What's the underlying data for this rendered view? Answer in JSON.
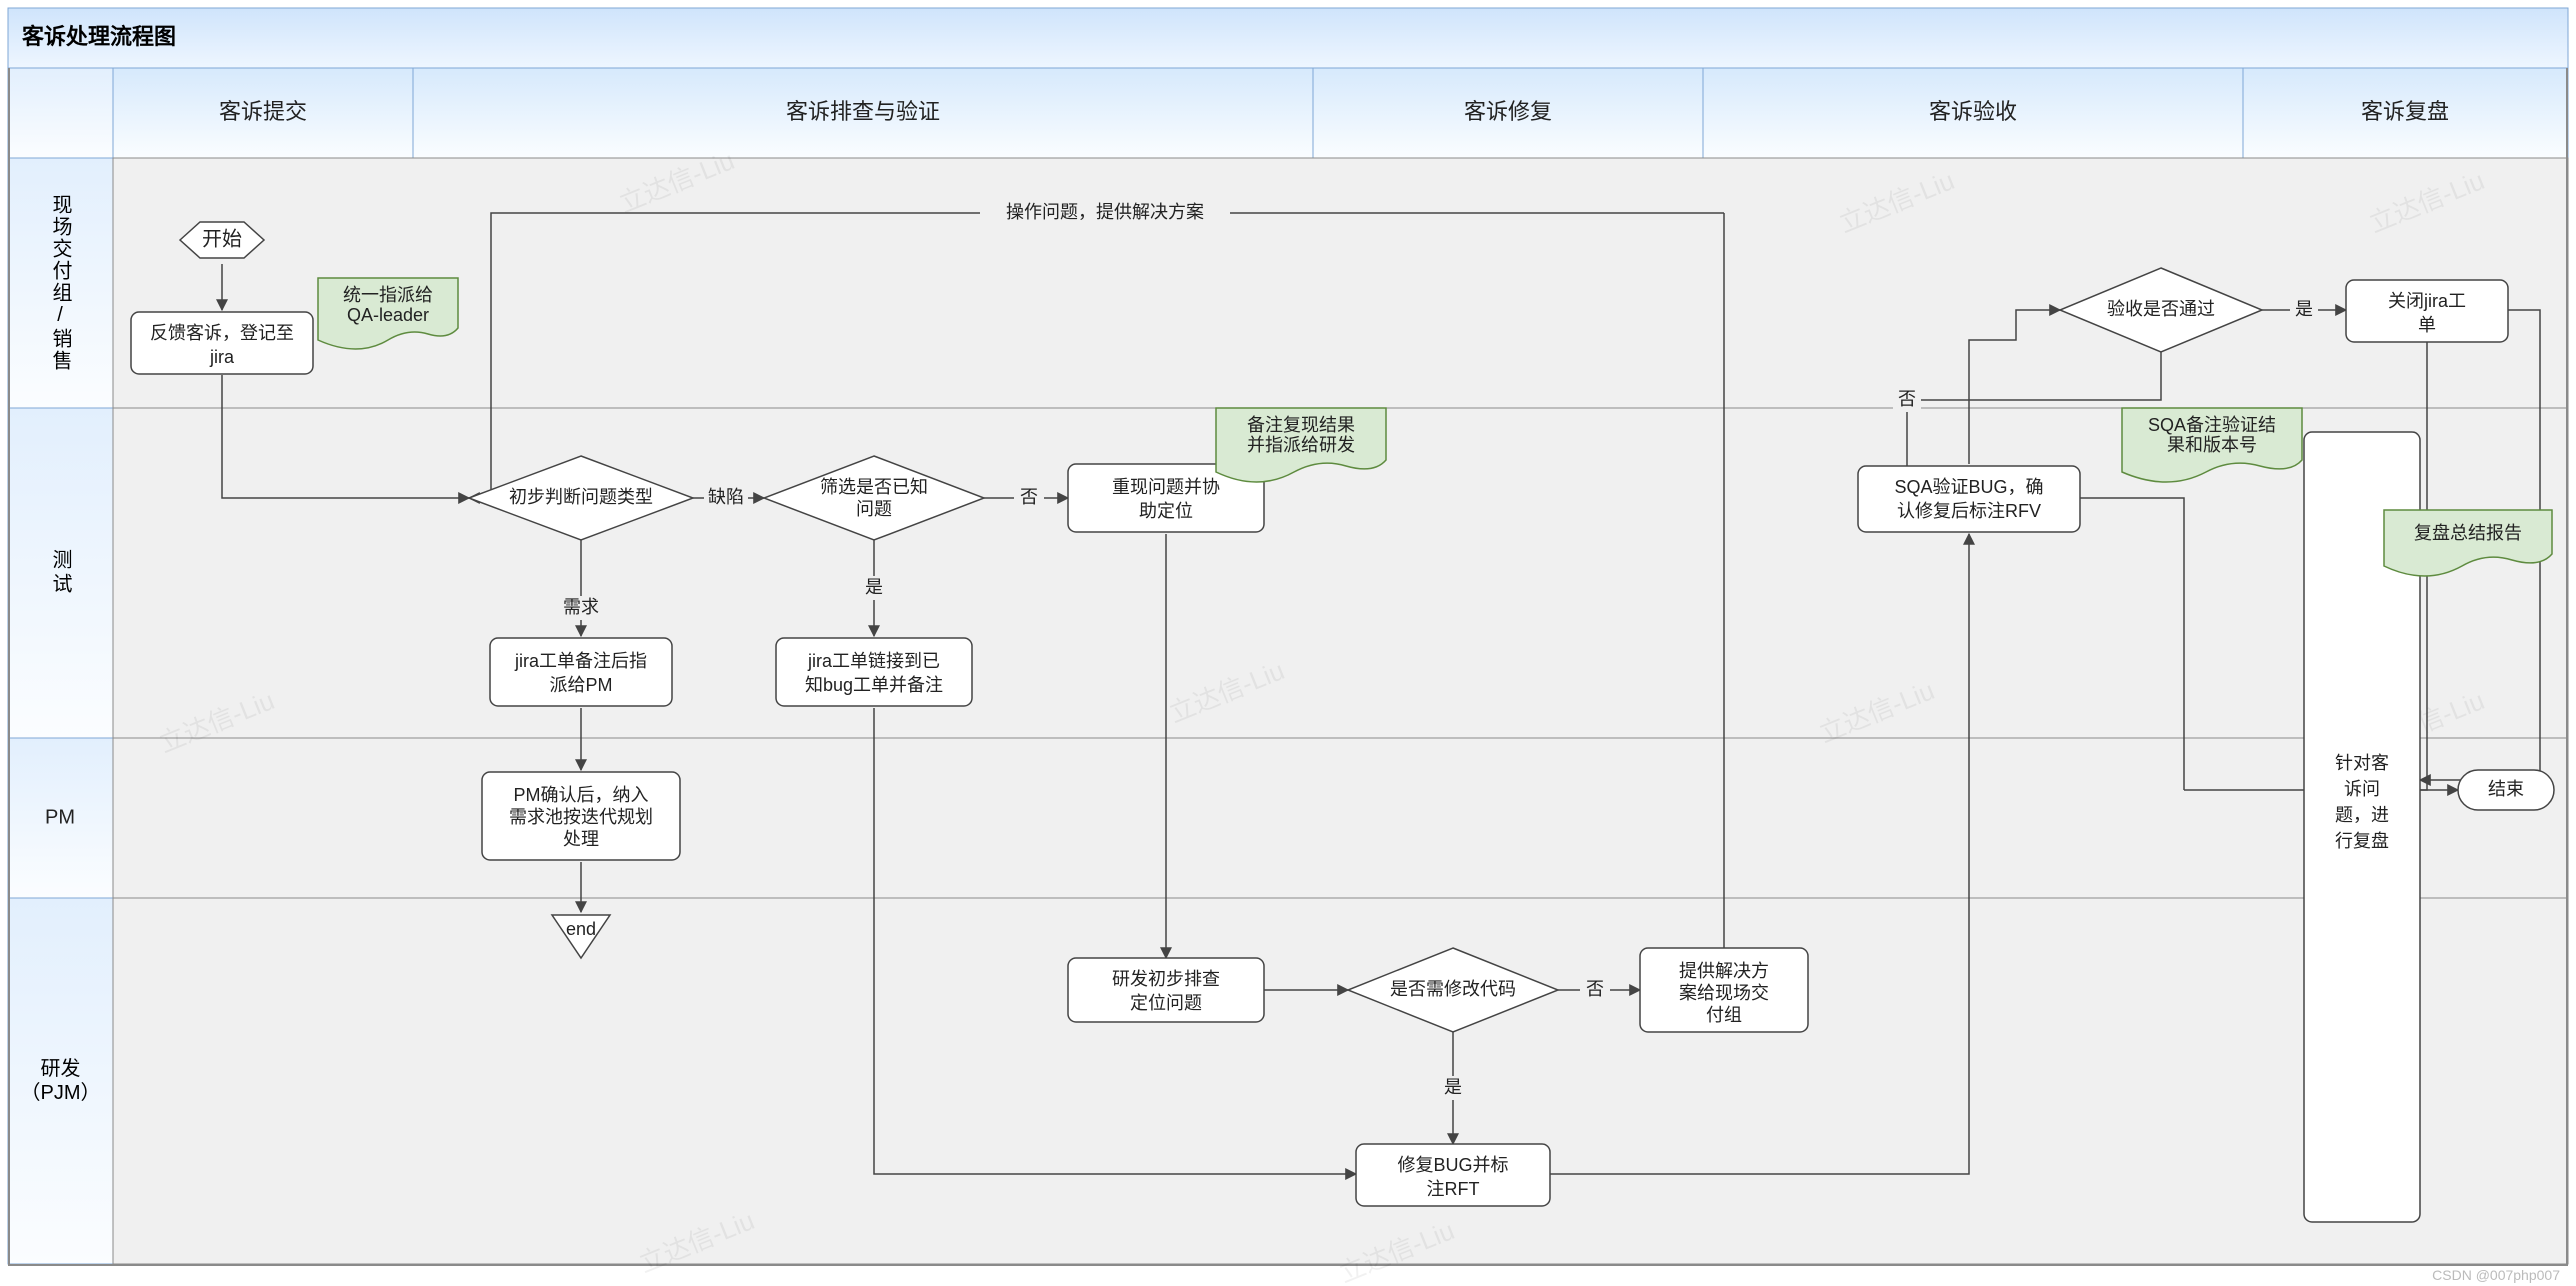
{
  "title": "客诉处理流程图",
  "phases": [
    "客诉提交",
    "客诉排查与验证",
    "客诉修复",
    "客诉验收",
    "客诉复盘"
  ],
  "lanes": {
    "l1": "现场交付组/销售",
    "l2": "测试",
    "l3": "PM",
    "l4": "研发（PJM）"
  },
  "nodes": {
    "start": "开始",
    "feedback": "反馈客诉，登记至jira",
    "note_qa": "统一指派给QA-leader",
    "decide_type": "初步判断问题类型",
    "decide_known": "筛选是否已知问题",
    "reproduce": "重现问题并协助定位",
    "note_repro": "备注复现结果并指派给研发",
    "assign_pm": "jira工单备注后指派给PM",
    "link_bug": "jira工单链接到已知bug工单并备注",
    "pm_confirm": "PM确认后，纳入需求池按迭代规划处理",
    "end_pm": "end",
    "dev_locate": "研发初步排查定位问题",
    "need_code": "是否需修改代码",
    "solution": "提供解决方案给现场交付组",
    "fix_rft": "修复BUG并标注RFT",
    "sqa_verify": "SQA验证BUG，确认修复后标注RFV",
    "note_sqa": "SQA备注验证结果和版本号",
    "pass": "验收是否通过",
    "close": "关闭jira工单",
    "review": "针对客诉问题，进行复盘",
    "note_review": "复盘总结报告",
    "end": "结束"
  },
  "edge_labels": {
    "defect": "缺陷",
    "req": "需求",
    "yes": "是",
    "no": "否",
    "op_issue": "操作问题，提供解决方案"
  },
  "credit": "CSDN @007php007",
  "watermark": "立达信-Liu"
}
